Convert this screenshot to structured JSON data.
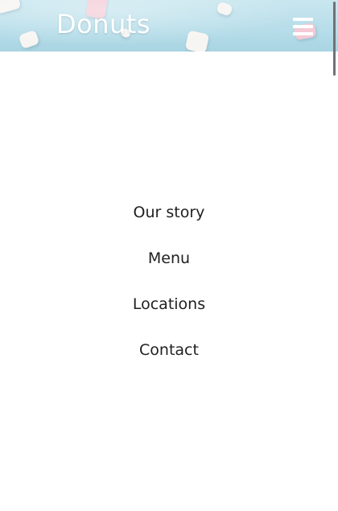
{
  "header": {
    "brand": "Donuts",
    "menu_icon": "hamburger-menu-icon",
    "background": "marshmallows-on-light-blue"
  },
  "nav": {
    "items": [
      {
        "label": "Our story"
      },
      {
        "label": "Menu"
      },
      {
        "label": "Locations"
      },
      {
        "label": "Contact"
      }
    ]
  },
  "colors": {
    "header_bg": "#b6dde9",
    "brand_text": "#ffffff",
    "nav_text": "#1f1f1f",
    "page_bg": "#ffffff"
  }
}
